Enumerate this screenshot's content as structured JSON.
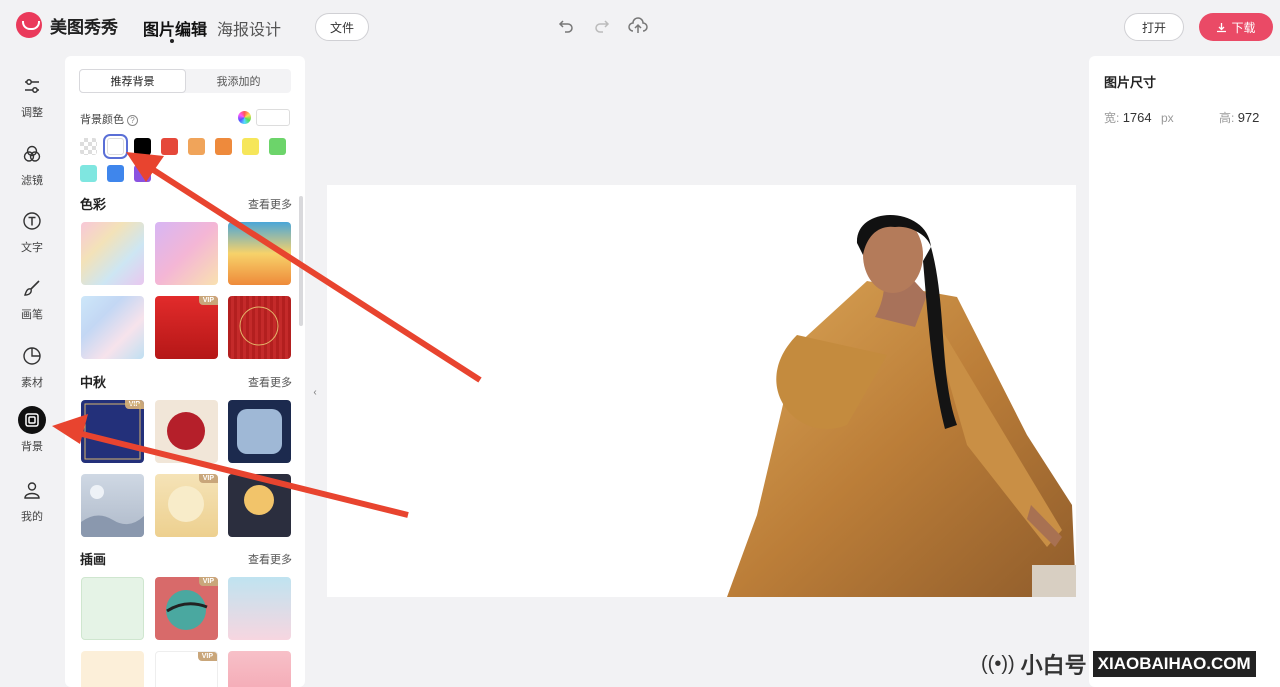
{
  "app": {
    "name": "美图秀秀"
  },
  "nav": {
    "tab_edit": "图片编辑",
    "tab_poster": "海报设计"
  },
  "toolbar": {
    "file_label": "文件",
    "open_label": "打开",
    "download_label": "下载"
  },
  "rail": {
    "items": [
      {
        "label": "调整",
        "icon": "sliders-icon"
      },
      {
        "label": "滤镜",
        "icon": "filter-icon"
      },
      {
        "label": "文字",
        "icon": "text-icon"
      },
      {
        "label": "画笔",
        "icon": "brush-icon"
      },
      {
        "label": "素材",
        "icon": "sticker-icon"
      },
      {
        "label": "背景",
        "icon": "background-icon"
      },
      {
        "label": "我的",
        "icon": "user-icon"
      }
    ],
    "active_index": 5
  },
  "panel": {
    "tabs": [
      "推荐背景",
      "我添加的"
    ],
    "bg_color_label": "背景颜色",
    "swatches": [
      "transparent",
      "#ffffff",
      "#000000",
      "#e5483a",
      "#f0a45a",
      "#ee8a3c",
      "#f6e65a",
      "#6cd46a",
      "#7fe6e0",
      "#3f86ec",
      "#8a52e0"
    ],
    "selected_swatch": 1,
    "sections": [
      {
        "title": "色彩",
        "more": "查看更多"
      },
      {
        "title": "中秋",
        "more": "查看更多"
      },
      {
        "title": "插画",
        "more": "查看更多"
      }
    ],
    "vip_label": "VIP"
  },
  "right_panel": {
    "title": "图片尺寸",
    "width_label": "宽:",
    "width_value": "1764",
    "unit": "px",
    "height_label": "高:",
    "height_value": "972"
  },
  "watermark": {
    "cn": "小白号",
    "en": "XIAOBAIHAO.COM"
  },
  "colors": {
    "accent": "#ea4a66",
    "arrow": "#e8442f",
    "selection": "#5a6fd6"
  }
}
